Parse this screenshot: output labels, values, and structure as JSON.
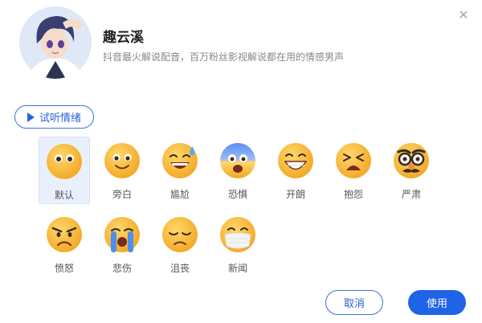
{
  "dialog": {
    "close_icon": "close-icon",
    "voice": {
      "name": "趣云溪",
      "description": "抖音最火解说配音，百万粉丝影视解说都在用的情感男声"
    },
    "preview_button": {
      "label": "试听情绪",
      "icon": "play-icon"
    },
    "emotions": [
      {
        "label": "默认",
        "icon": "neutral-face-icon",
        "selected": true
      },
      {
        "label": "旁白",
        "icon": "smiling-face-icon",
        "selected": false
      },
      {
        "label": "尴尬",
        "icon": "grinning-sweat-face-icon",
        "selected": false
      },
      {
        "label": "恐惧",
        "icon": "fearful-face-icon",
        "selected": false
      },
      {
        "label": "开朗",
        "icon": "grinning-face-icon",
        "selected": false
      },
      {
        "label": "抱怨",
        "icon": "persevering-face-icon",
        "selected": false
      },
      {
        "label": "严肃",
        "icon": "disguised-face-icon",
        "selected": false
      },
      {
        "label": "愤怒",
        "icon": "angry-face-icon",
        "selected": false
      },
      {
        "label": "悲伤",
        "icon": "crying-face-icon",
        "selected": false
      },
      {
        "label": "沮丧",
        "icon": "pensive-face-icon",
        "selected": false
      },
      {
        "label": "新闻",
        "icon": "masked-face-icon",
        "selected": false
      }
    ],
    "cancel_label": "取消",
    "use_label": "使用",
    "colors": {
      "accent": "#1f63e6",
      "emoji_base": "#f5b231",
      "selected_bg": "#e9f0fb"
    }
  }
}
